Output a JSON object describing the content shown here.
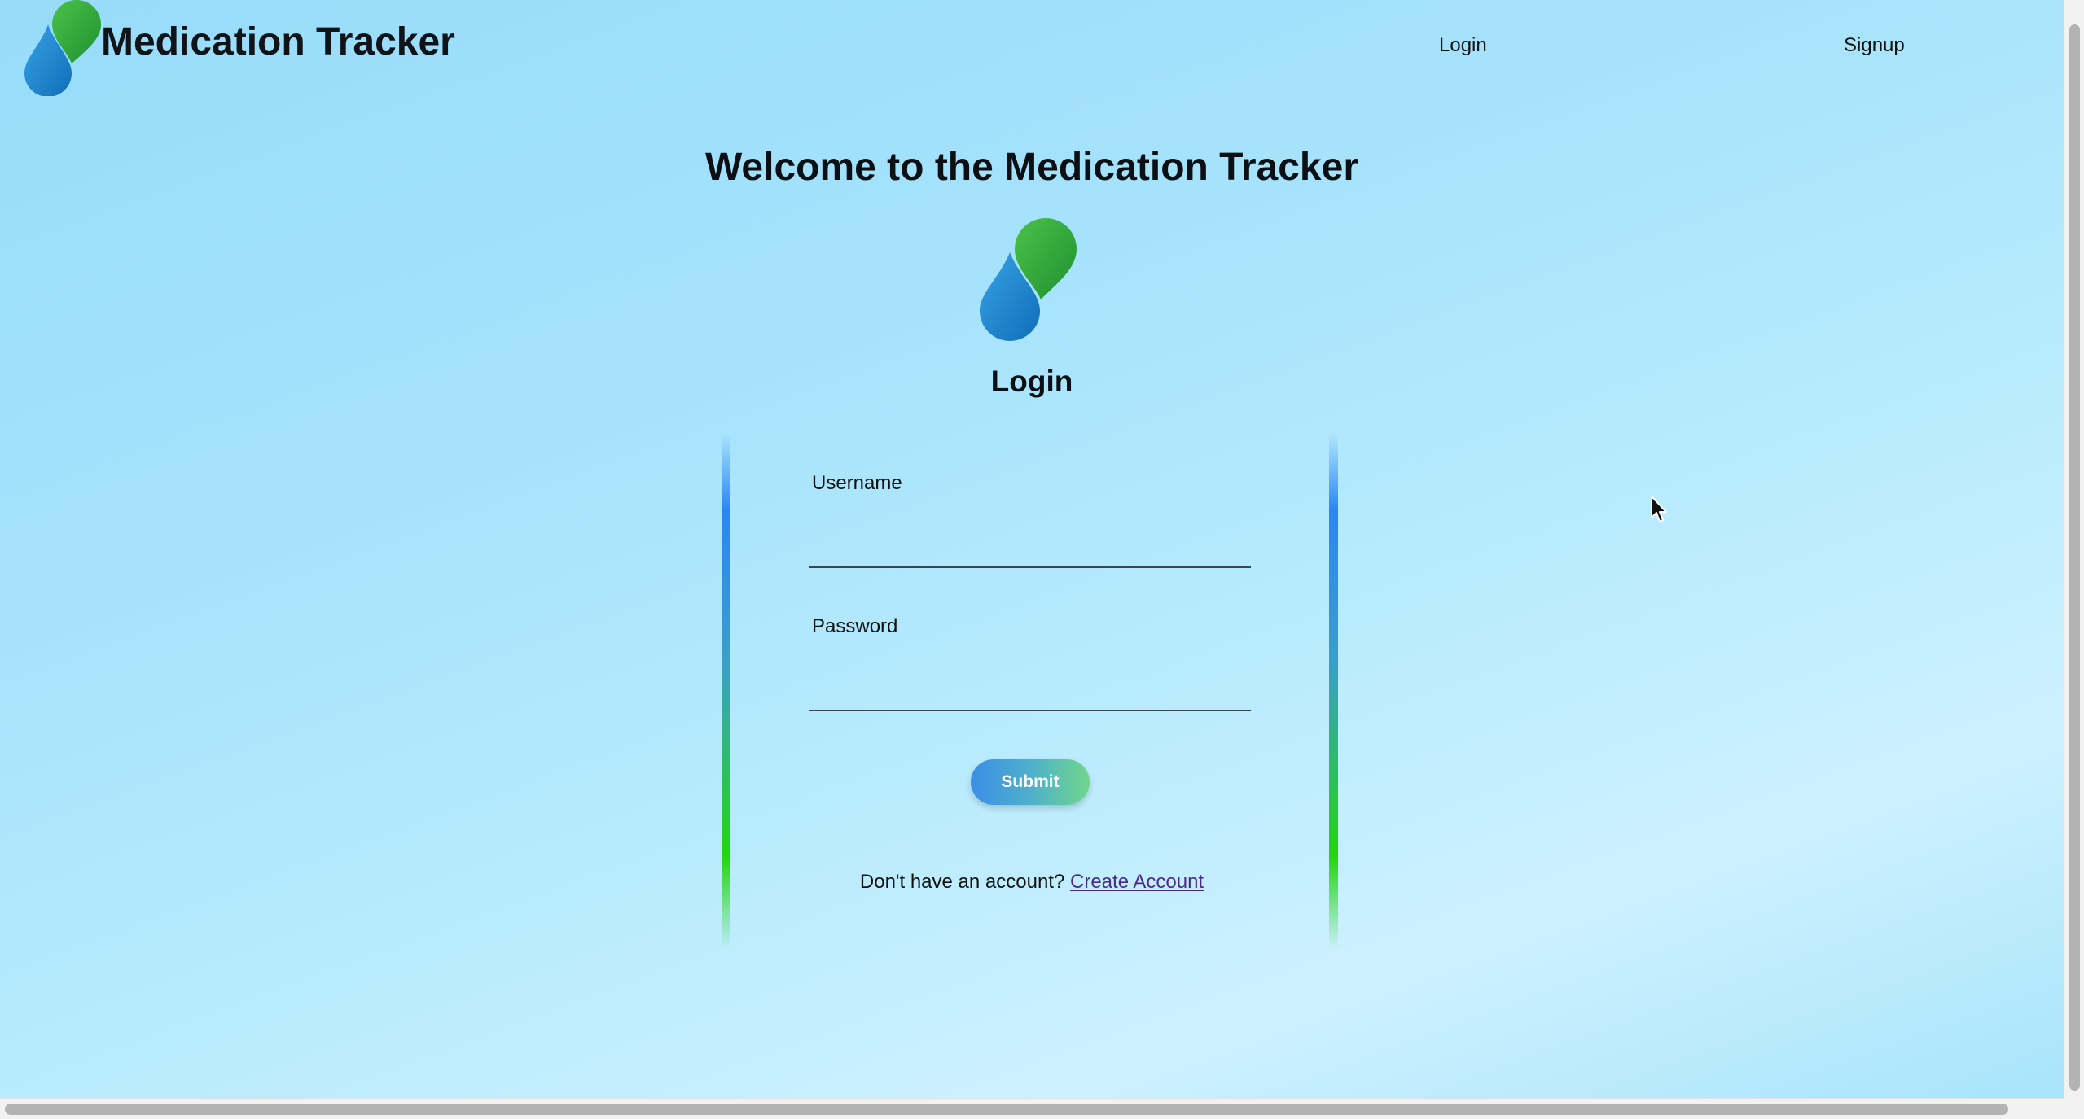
{
  "header": {
    "title": "Medication Tracker",
    "nav": {
      "login": "Login",
      "signup": "Signup"
    },
    "logo_icon": "droplets-logo-icon"
  },
  "main": {
    "welcome": "Welcome to the Medication Tracker",
    "logo_icon": "droplets-logo-icon",
    "form_title": "Login",
    "username_label": "Username",
    "username_value": "",
    "password_label": "Password",
    "password_value": "",
    "submit_label": "Submit",
    "account_prompt": "Don't have an account?",
    "create_account_link": "Create Account"
  },
  "colors": {
    "drop_blue": "#1f86d6",
    "drop_green": "#2ea83a",
    "bar_top": "#2b86f5",
    "bar_bottom": "#22d60c",
    "link": "#4b2a8a"
  }
}
